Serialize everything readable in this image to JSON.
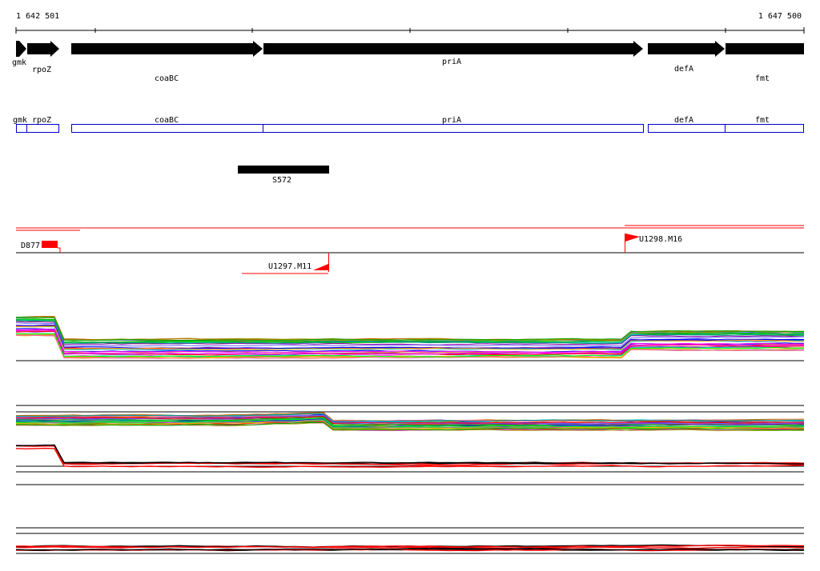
{
  "ruler": {
    "start": "1 642 501",
    "end": "1 647 500"
  },
  "genes": [
    {
      "name": "gmk",
      "strand": "+"
    },
    {
      "name": "rpoZ",
      "strand": "+"
    },
    {
      "name": "coaBC",
      "strand": "+"
    },
    {
      "name": "priA",
      "strand": "+"
    },
    {
      "name": "defA",
      "strand": "+"
    },
    {
      "name": "fmt",
      "strand": "+"
    }
  ],
  "cds_labels": [
    "gmk",
    "rpoZ",
    "coaBC",
    "priA",
    "defA",
    "fmt"
  ],
  "features": {
    "segment": "S572",
    "transcripts": [
      "D877",
      "U1298.M16",
      "U1297.M11"
    ]
  },
  "colors": {
    "gene": "#000000",
    "cds_outline": "#0000cc",
    "transcript": "#ff0000",
    "axis": "#000000",
    "background": "#ffffff"
  }
}
